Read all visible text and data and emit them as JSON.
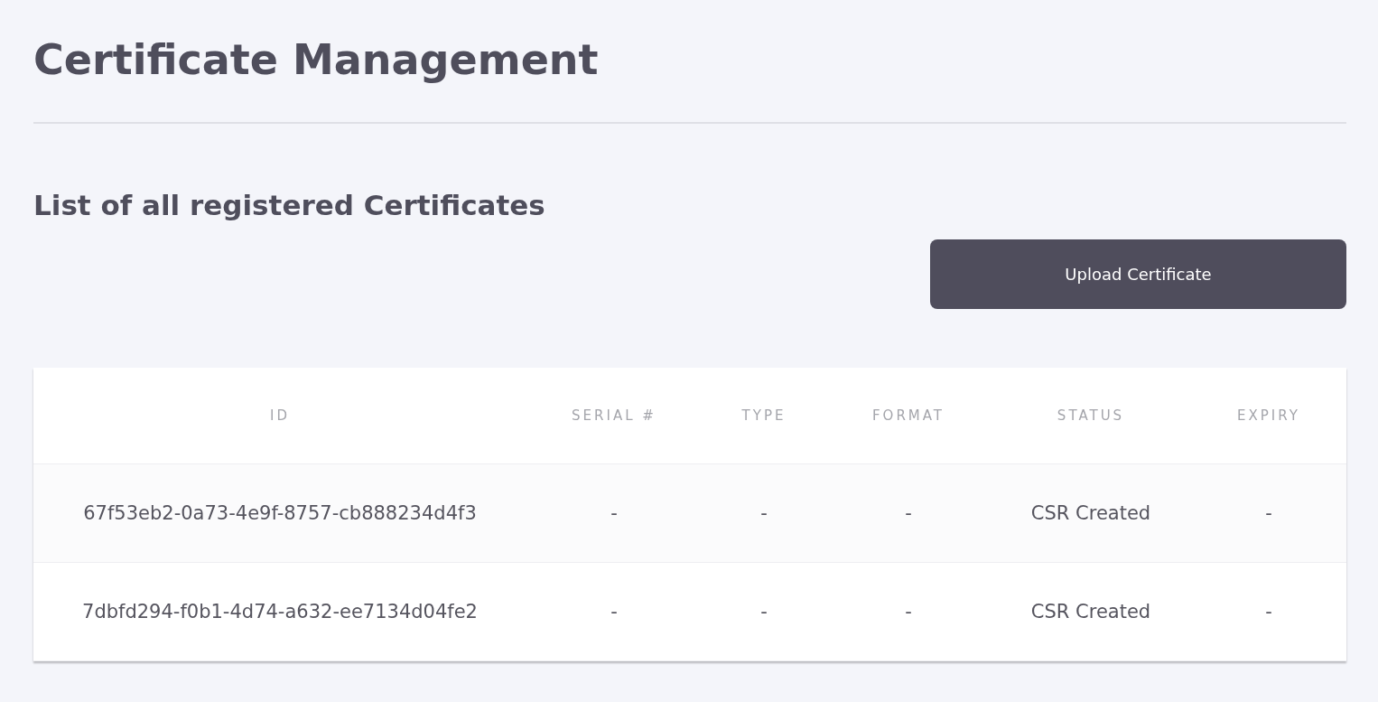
{
  "page": {
    "title": "Certificate Management",
    "subtitle": "List of all registered Certificates"
  },
  "upload_button": {
    "label": "Upload Certificate"
  },
  "table": {
    "columns": [
      "ID",
      "SERIAL #",
      "TYPE",
      "FORMAT",
      "STATUS",
      "EXPIRY"
    ],
    "rows": [
      [
        "67f53eb2-0a73-4e9f-8757-cb888234d4f3",
        "-",
        "-",
        "-",
        "CSR Created",
        "-"
      ],
      [
        "7dbfd294-f0b1-4d74-a632-ee7134d04fe2",
        "-",
        "-",
        "-",
        "CSR Created",
        "-"
      ]
    ]
  }
}
